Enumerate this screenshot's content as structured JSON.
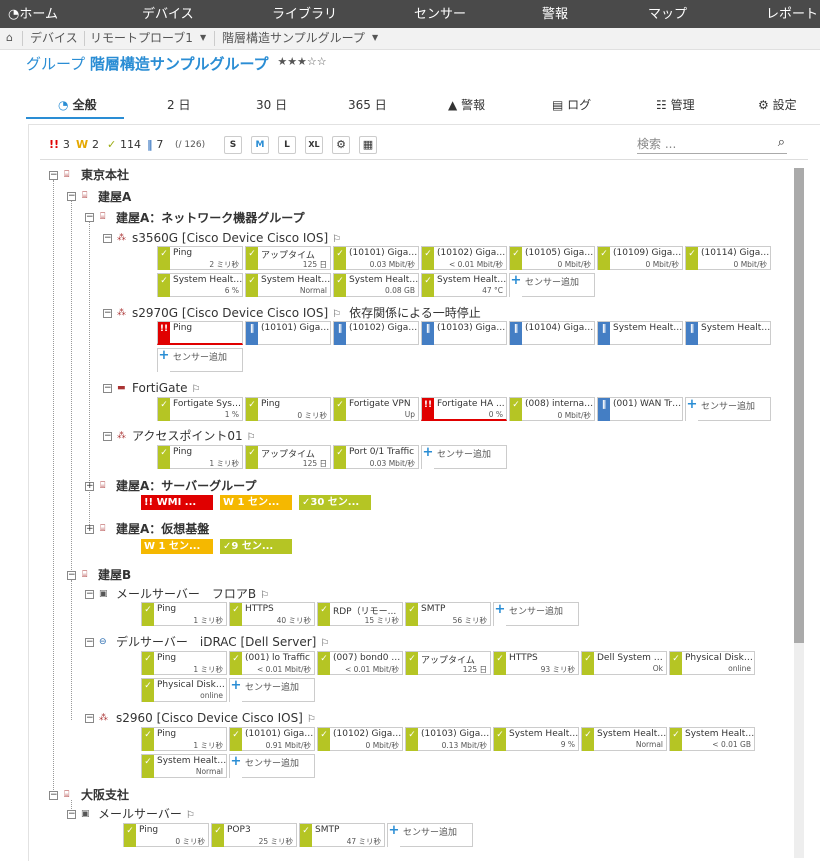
{
  "topnav": {
    "home": "ホーム",
    "devices": "デバイス",
    "libraries": "ライブラリ",
    "sensors": "センサー",
    "alarms": "警報",
    "maps": "マップ",
    "reports": "レポート"
  },
  "breadcrumb": {
    "items": [
      "デバイス",
      "リモートプローブ1",
      "階層構造サンプルグループ"
    ]
  },
  "page": {
    "prefix": "グループ",
    "name": "階層構造サンプルグループ",
    "stars": "★★★☆☆"
  },
  "tabs": [
    "全般",
    "2 日",
    "30 日",
    "365 日",
    "警報",
    "ログ",
    "管理",
    "設定"
  ],
  "filter": {
    "down": "3",
    "warning": "2",
    "up": "114",
    "paused": "7",
    "total": "(/ 126)",
    "sizes": [
      "S",
      "M",
      "L",
      "XL"
    ],
    "search_placeholder": "検索 ..."
  },
  "tree": {
    "tokyo": "東京本社",
    "bldgA": "建屋A",
    "netgroup": "建屋A：ネットワーク機器グループ",
    "dev1": "s3560G [Cisco Device Cisco IOS]",
    "dev2": "s2970G [Cisco Device Cisco IOS]",
    "dev2_note": "依存関係による一時停止",
    "dev3": "FortiGate",
    "dev4": "アクセスポイント01",
    "servergroup": "建屋A：サーバーグループ",
    "vgroup": "建屋A：仮想基盤",
    "bldgB": "建屋B",
    "mail": "メールサーバー　フロアB",
    "dell": "デルサーバー　iDRAC [Dell Server]",
    "s2960": "s2960 [Cisco Device Cisco IOS]",
    "osaka": "大阪支社",
    "mail2": "メールサーバー"
  },
  "add_label": "センサー追加",
  "summaries": {
    "server_down": "!! WMI ...",
    "server_warn": "W 1 セン...",
    "server_up": "✓30 セン...",
    "virt_warn": "W 1 セン...",
    "virt_up": "✓9 セン..."
  },
  "sensors": {
    "d1": [
      {
        "name": "Ping",
        "value": "2 ミリ秒",
        "status": "up"
      },
      {
        "name": "アップタイム",
        "value": "125 日",
        "status": "up"
      },
      {
        "name": "(10101) Gigabi...",
        "value": "0.03 Mbit/秒",
        "status": "up"
      },
      {
        "name": "(10102) Gigabi...",
        "value": "< 0.01 Mbit/秒",
        "status": "up"
      },
      {
        "name": "(10105) Gigabi...",
        "value": "0 Mbit/秒",
        "status": "up"
      },
      {
        "name": "(10109) Gigabi...",
        "value": "0 Mbit/秒",
        "status": "up"
      },
      {
        "name": "(10114) Gigabi...",
        "value": "0 Mbit/秒",
        "status": "up"
      },
      {
        "name": "System Health ...",
        "value": "6 %",
        "status": "up"
      },
      {
        "name": "System Health ...",
        "value": "Normal",
        "status": "up"
      },
      {
        "name": "System Health ...",
        "value": "0.08 GB",
        "status": "up"
      },
      {
        "name": "System Health ...",
        "value": "47 °C",
        "status": "up"
      }
    ],
    "d2": [
      {
        "name": "Ping",
        "value": "",
        "status": "down"
      },
      {
        "name": "(10101) Gigabi...",
        "value": "",
        "status": "paused"
      },
      {
        "name": "(10102) Gigabi...",
        "value": "",
        "status": "paused"
      },
      {
        "name": "(10103) Gigabi...",
        "value": "",
        "status": "paused"
      },
      {
        "name": "(10104) Gigabi...",
        "value": "",
        "status": "paused"
      },
      {
        "name": "System Health ...",
        "value": "",
        "status": "paused"
      },
      {
        "name": "System Health ...",
        "value": "",
        "status": "paused"
      }
    ],
    "d3": [
      {
        "name": "Fortigate Syste...",
        "value": "1 %",
        "status": "up"
      },
      {
        "name": "Ping",
        "value": "0 ミリ秒",
        "status": "up"
      },
      {
        "name": "Fortigate VPN",
        "value": "Up",
        "status": "up"
      },
      {
        "name": "Fortigate HA ...",
        "value": "0 %",
        "status": "down"
      },
      {
        "name": "(008) internal2 ...",
        "value": "0 Mbit/秒",
        "status": "up"
      },
      {
        "name": "(001) WAN Traf...",
        "value": "",
        "status": "paused"
      }
    ],
    "d4": [
      {
        "name": "Ping",
        "value": "1 ミリ秒",
        "status": "up"
      },
      {
        "name": "アップタイム",
        "value": "125 日",
        "status": "up"
      },
      {
        "name": "Port 0/1 Traffic",
        "value": "0.03 Mbit/秒",
        "status": "up"
      }
    ],
    "mail": [
      {
        "name": "Ping",
        "value": "1 ミリ秒",
        "status": "up"
      },
      {
        "name": "HTTPS",
        "value": "40 ミリ秒",
        "status": "up"
      },
      {
        "name": "RDP（リモー...",
        "value": "15 ミリ秒",
        "status": "up"
      },
      {
        "name": "SMTP",
        "value": "56 ミリ秒",
        "status": "up"
      }
    ],
    "dell": [
      {
        "name": "Ping",
        "value": "1 ミリ秒",
        "status": "up"
      },
      {
        "name": "(001) lo Traffic",
        "value": "< 0.01 Mbit/秒",
        "status": "up"
      },
      {
        "name": "(007) bond0 Tr...",
        "value": "< 0.01 Mbit/秒",
        "status": "up"
      },
      {
        "name": "アップタイム",
        "value": "125 日",
        "status": "up"
      },
      {
        "name": "HTTPS",
        "value": "93 ミリ秒",
        "status": "up"
      },
      {
        "name": "Dell System He...",
        "value": "Ok",
        "status": "up"
      },
      {
        "name": "Physical Disk 0:...",
        "value": "online",
        "status": "up"
      },
      {
        "name": "Physical Disk 0:...",
        "value": "online",
        "status": "up"
      }
    ],
    "s2960": [
      {
        "name": "Ping",
        "value": "1 ミリ秒",
        "status": "up"
      },
      {
        "name": "(10101) Gigabi...",
        "value": "0.91 Mbit/秒",
        "status": "up"
      },
      {
        "name": "(10102) Gigabi...",
        "value": "0 Mbit/秒",
        "status": "up"
      },
      {
        "name": "(10103) Gigabi...",
        "value": "0.13 Mbit/秒",
        "status": "up"
      },
      {
        "name": "System Health ...",
        "value": "9 %",
        "status": "up"
      },
      {
        "name": "System Health ...",
        "value": "Normal",
        "status": "up"
      },
      {
        "name": "System Health ...",
        "value": "< 0.01 GB",
        "status": "up"
      },
      {
        "name": "System Health ...",
        "value": "Normal",
        "status": "up"
      }
    ],
    "mail2": [
      {
        "name": "Ping",
        "value": "0 ミリ秒",
        "status": "up"
      },
      {
        "name": "POP3",
        "value": "25 ミリ秒",
        "status": "up"
      },
      {
        "name": "SMTP",
        "value": "47 ミリ秒",
        "status": "up"
      }
    ]
  },
  "colors": {
    "up": "#b5c524",
    "down": "#e00000",
    "warning": "#f5b800",
    "paused": "#447ec4",
    "accent": "#2a8dd4",
    "nav": "#4a4a4a"
  }
}
